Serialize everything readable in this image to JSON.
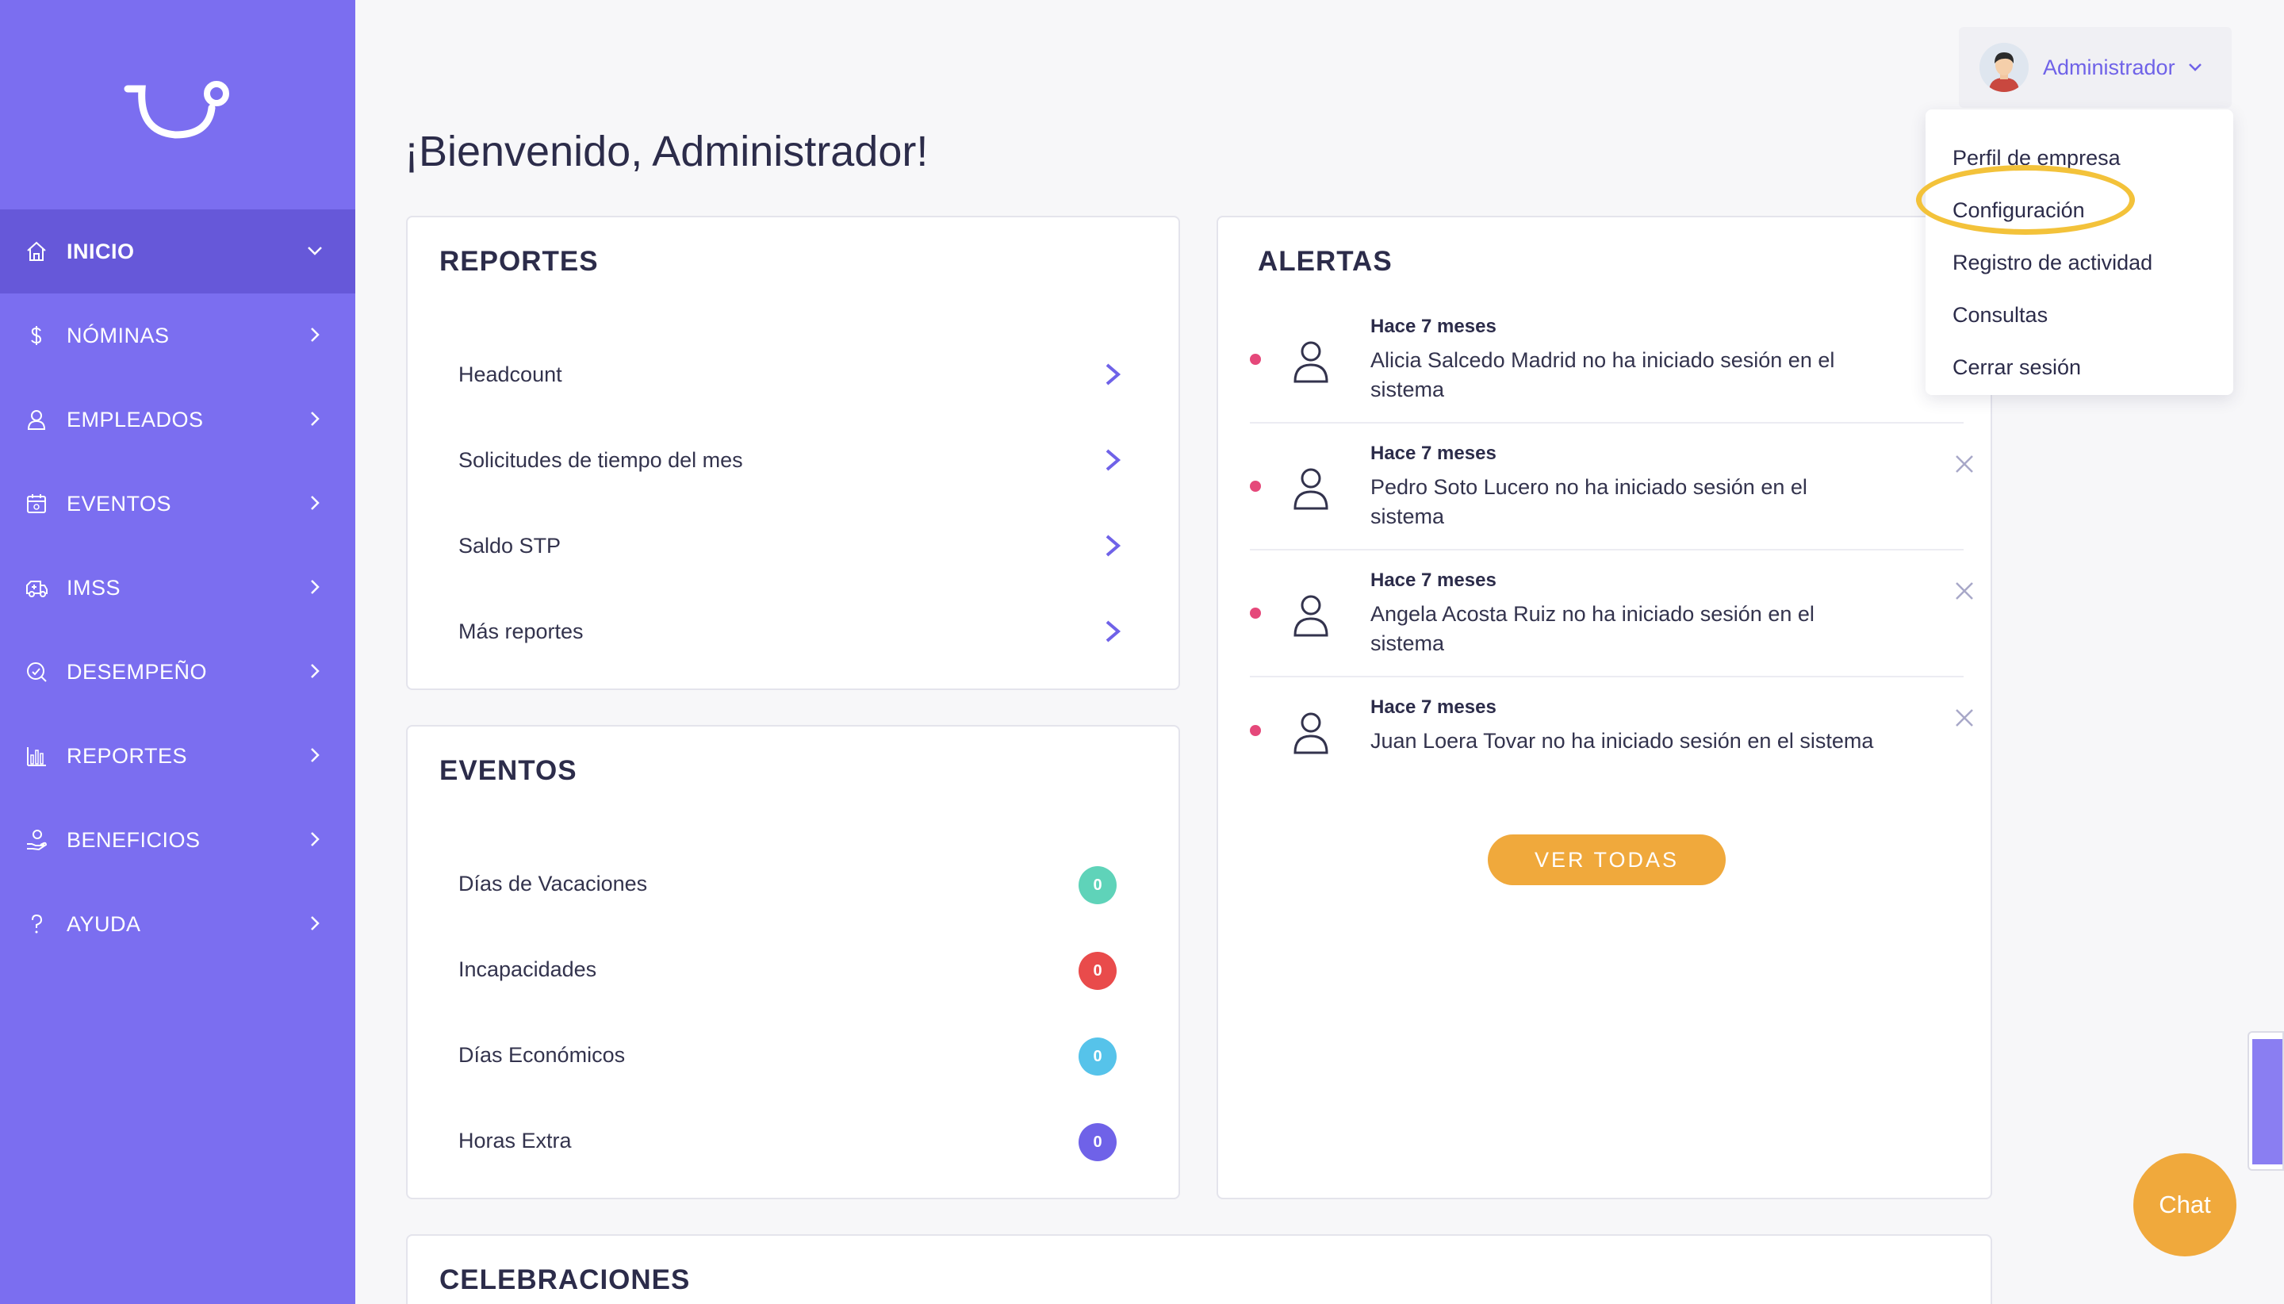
{
  "sidebar": {
    "items": [
      {
        "label": "INICIO",
        "icon": "home-icon",
        "active": true
      },
      {
        "label": "NÓMINAS",
        "icon": "dollar-icon"
      },
      {
        "label": "EMPLEADOS",
        "icon": "user-icon"
      },
      {
        "label": "EVENTOS",
        "icon": "calendar-icon"
      },
      {
        "label": "IMSS",
        "icon": "ambulance-icon"
      },
      {
        "label": "DESEMPEÑO",
        "icon": "performance-icon"
      },
      {
        "label": "REPORTES",
        "icon": "bar-chart-icon"
      },
      {
        "label": "BENEFICIOS",
        "icon": "benefits-icon"
      },
      {
        "label": "AYUDA",
        "icon": "question-icon"
      }
    ]
  },
  "header": {
    "welcome": "¡Bienvenido, Administrador!",
    "user": "Administrador"
  },
  "dropdown": {
    "items": [
      "Perfil de empresa",
      "Configuración",
      "Registro de actividad",
      "Consultas",
      "Cerrar sesión"
    ]
  },
  "reportes": {
    "title": "REPORTES",
    "items": [
      "Headcount",
      "Solicitudes de tiempo del mes",
      "Saldo STP",
      "Más reportes"
    ]
  },
  "eventos": {
    "title": "EVENTOS",
    "items": [
      {
        "label": "Días de Vacaciones",
        "count": "0",
        "color": "#5fd3b9"
      },
      {
        "label": "Incapacidades",
        "count": "0",
        "color": "#e94b4b"
      },
      {
        "label": "Días Económicos",
        "count": "0",
        "color": "#56c3ea"
      },
      {
        "label": "Horas Extra",
        "count": "0",
        "color": "#6f62e8"
      }
    ]
  },
  "alertas": {
    "title": "ALERTAS",
    "items": [
      {
        "time": "Hace 7 meses",
        "text": "Alicia Salcedo Madrid no ha iniciado sesión en el sistema"
      },
      {
        "time": "Hace 7 meses",
        "text": "Pedro Soto Lucero no ha iniciado sesión en el sistema"
      },
      {
        "time": "Hace 7 meses",
        "text": "Angela Acosta Ruiz no ha iniciado sesión en el sistema"
      },
      {
        "time": "Hace 7 meses",
        "text": "Juan Loera Tovar no ha iniciado sesión en el sistema"
      }
    ],
    "button": "VER TODAS"
  },
  "celebraciones": {
    "title": "CELEBRACIONES"
  },
  "chat": {
    "label": "Chat"
  },
  "colors": {
    "sidebar": "#7b6ef0",
    "accent": "#f0a93c",
    "highlight": "#f3c23a"
  }
}
